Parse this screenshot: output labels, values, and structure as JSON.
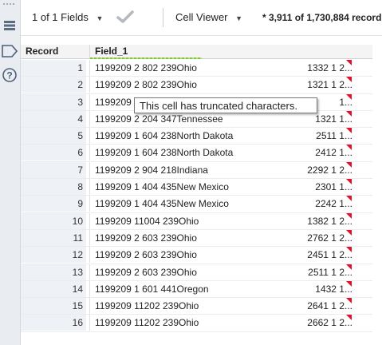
{
  "toolbar": {
    "fields_label": "1 of 1 Fields",
    "cell_viewer_label": "Cell Viewer",
    "record_count": "* 3,911 of 1,730,884 record"
  },
  "grid": {
    "columns": [
      "Record",
      "Field_1"
    ],
    "rows": [
      {
        "num": "1",
        "v1": "1199209  2 802  239Ohio",
        "v2": "1332  1  2..."
      },
      {
        "num": "2",
        "v1": "1199209  2 802  239Ohio",
        "v2": "1321  1  2..."
      },
      {
        "num": "3",
        "v1": "1199209  2 802  239Ohio",
        "v2": "1..."
      },
      {
        "num": "4",
        "v1": "1199209  2 204  347Tennessee",
        "v2": "1321  1..."
      },
      {
        "num": "5",
        "v1": "1199209  1 604  238North Dakota",
        "v2": "2511  1..."
      },
      {
        "num": "6",
        "v1": "1199209  1 604  238North Dakota",
        "v2": "2412  1..."
      },
      {
        "num": "7",
        "v1": "1199209  2 904  218Indiana",
        "v2": "2292  1  2..."
      },
      {
        "num": "8",
        "v1": "1199209  1 404  435New Mexico",
        "v2": "2301  1..."
      },
      {
        "num": "9",
        "v1": "1199209  1 404  435New Mexico",
        "v2": "2242  1..."
      },
      {
        "num": "10",
        "v1": "1199209  11004  239Ohio",
        "v2": "1382  1  2..."
      },
      {
        "num": "11",
        "v1": "1199209  2 603  239Ohio",
        "v2": "2762  1  2..."
      },
      {
        "num": "12",
        "v1": "1199209  2 603  239Ohio",
        "v2": "2451  1  2..."
      },
      {
        "num": "13",
        "v1": "1199209  2 603  239Ohio",
        "v2": "2511  1  2..."
      },
      {
        "num": "14",
        "v1": "1199209  1 601  441Oregon",
        "v2": "1432  1..."
      },
      {
        "num": "15",
        "v1": "1199209  11202  239Ohio",
        "v2": "2641  1  2..."
      },
      {
        "num": "16",
        "v1": "1199209  11202  239Ohio",
        "v2": "2662  1  2..."
      }
    ]
  },
  "tooltip": {
    "text": "This cell has truncated characters."
  },
  "colors": {
    "flag": "#e0112b",
    "accent_green": "#7ec13a"
  },
  "icons": [
    "dots-icon",
    "list-icon",
    "tag-icon",
    "help-icon",
    "chevron-down-icon",
    "checkmark-icon"
  ]
}
